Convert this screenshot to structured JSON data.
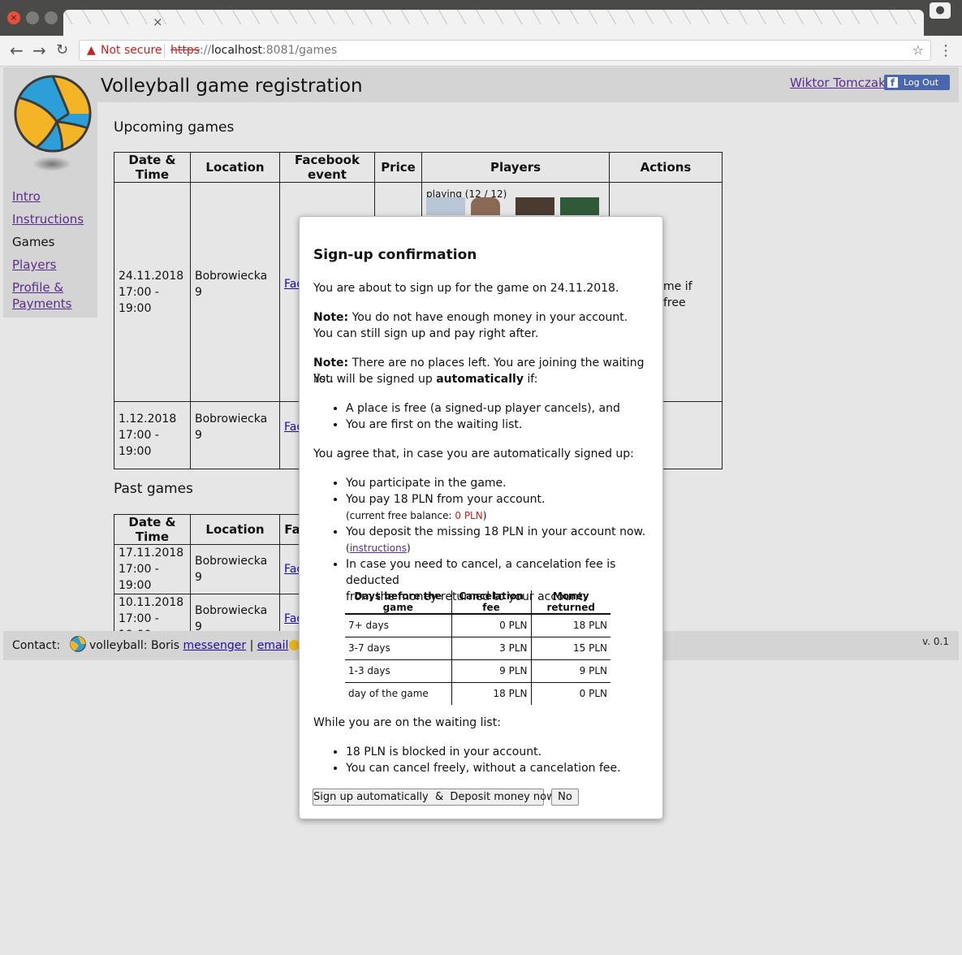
{
  "browser": {
    "security_label": "Not secure",
    "url_scheme": "https",
    "url_sep": "://",
    "url_host": "localhost",
    "url_rest": ":8081/games",
    "tab_close": "×"
  },
  "header": {
    "title": "Volleyball game registration",
    "user_name": "Wiktor Tomczak",
    "logout_label": "Log Out"
  },
  "sidebar": {
    "items": [
      {
        "label": "Intro"
      },
      {
        "label": "Instructions"
      },
      {
        "label": "Games"
      },
      {
        "label": "Players"
      },
      {
        "label": "Profile &"
      },
      {
        "label": "Payments"
      }
    ]
  },
  "upcoming": {
    "title": "Upcoming games",
    "headers": [
      "Date & Time",
      "Location",
      "Facebook event",
      "Price",
      "Players",
      "Actions"
    ],
    "rows": [
      {
        "date": "24.11.2018",
        "time": "17:00 - 19:00",
        "location": "Bobrowiecka 9",
        "fb": "Fac",
        "playing": "playing (12 / 12)",
        "action_line1": "me if",
        "action_line2": "free"
      },
      {
        "date": "1.12.2018",
        "time": "17:00 - 19:00",
        "location": "Bobrowiecka 9",
        "fb": "Fac"
      }
    ]
  },
  "past": {
    "title": "Past games",
    "headers": [
      "Date & Time",
      "Location",
      "Fac"
    ],
    "rows": [
      {
        "date": "17.11.2018",
        "time": "17:00 - 19:00",
        "location": "Bobrowiecka 9",
        "fb": "Fac"
      },
      {
        "date": "10.11.2018",
        "time": "17:00 - 19:00",
        "location": "Bobrowiecka 9",
        "fb": "Fac"
      }
    ]
  },
  "footer": {
    "contact_label": "Contact:",
    "contact_text": "volleyball: Boris",
    "messenger": "messenger",
    "sep": "|",
    "email": "email",
    "version": "v. 0.1"
  },
  "modal": {
    "title": "Sign-up confirmation",
    "intro": "You are about to sign up for the game on 24.11.2018.",
    "note_label": "Note:",
    "note1_line1": "You do not have enough money in your account.",
    "note1_line2": "You can still sign up and pay right after.",
    "note2_line1": "There are no places left. You are joining the waiting list.",
    "note2_line2_pre": "You will be signed up",
    "note2_line2_bold": "automatically",
    "note2_line2_post": "if:",
    "conditions": [
      "A place is free (a signed-up player cancels), and",
      "You are first on the waiting list."
    ],
    "agree": "You agree that, in case you are automatically signed up:",
    "agree_items": {
      "participate": "You participate in the game.",
      "pay": "You pay 18 PLN from your account.",
      "balance_label": "(current free balance:",
      "balance_value": "0 PLN",
      "balance_close": ")",
      "deposit": "You deposit the missing 18 PLN in your account now.",
      "instructions_open": "(",
      "instructions_link": "instructions",
      "instructions_close": ")",
      "cancel_line1": "In case you need to cancel, a cancelation fee is deducted",
      "cancel_line2": "from the money returned to your account:"
    },
    "fee_table": {
      "headers": [
        "Days before the game",
        "Cancelation fee",
        "Money returned"
      ],
      "rows": [
        [
          "7+ days",
          "0 PLN",
          "18 PLN"
        ],
        [
          "3-7 days",
          "3 PLN",
          "15 PLN"
        ],
        [
          "1-3 days",
          "9 PLN",
          "9 PLN"
        ],
        [
          "day of the game",
          "18 PLN",
          "0 PLN"
        ]
      ]
    },
    "waiting": "While you are on the waiting list:",
    "waiting_items": [
      "18 PLN is blocked in your account.",
      "You can cancel freely, without a cancelation fee."
    ],
    "confirm_button": "Sign up automatically  &  Deposit money now",
    "no_button": "No"
  },
  "colors": {
    "link_visited": "#5b2d8e",
    "link": "#1a0dab",
    "warning": "#c5221f",
    "facebook": "#4a67ad",
    "ball_yellow": "#f3b526",
    "ball_blue": "#2d9fd8"
  }
}
